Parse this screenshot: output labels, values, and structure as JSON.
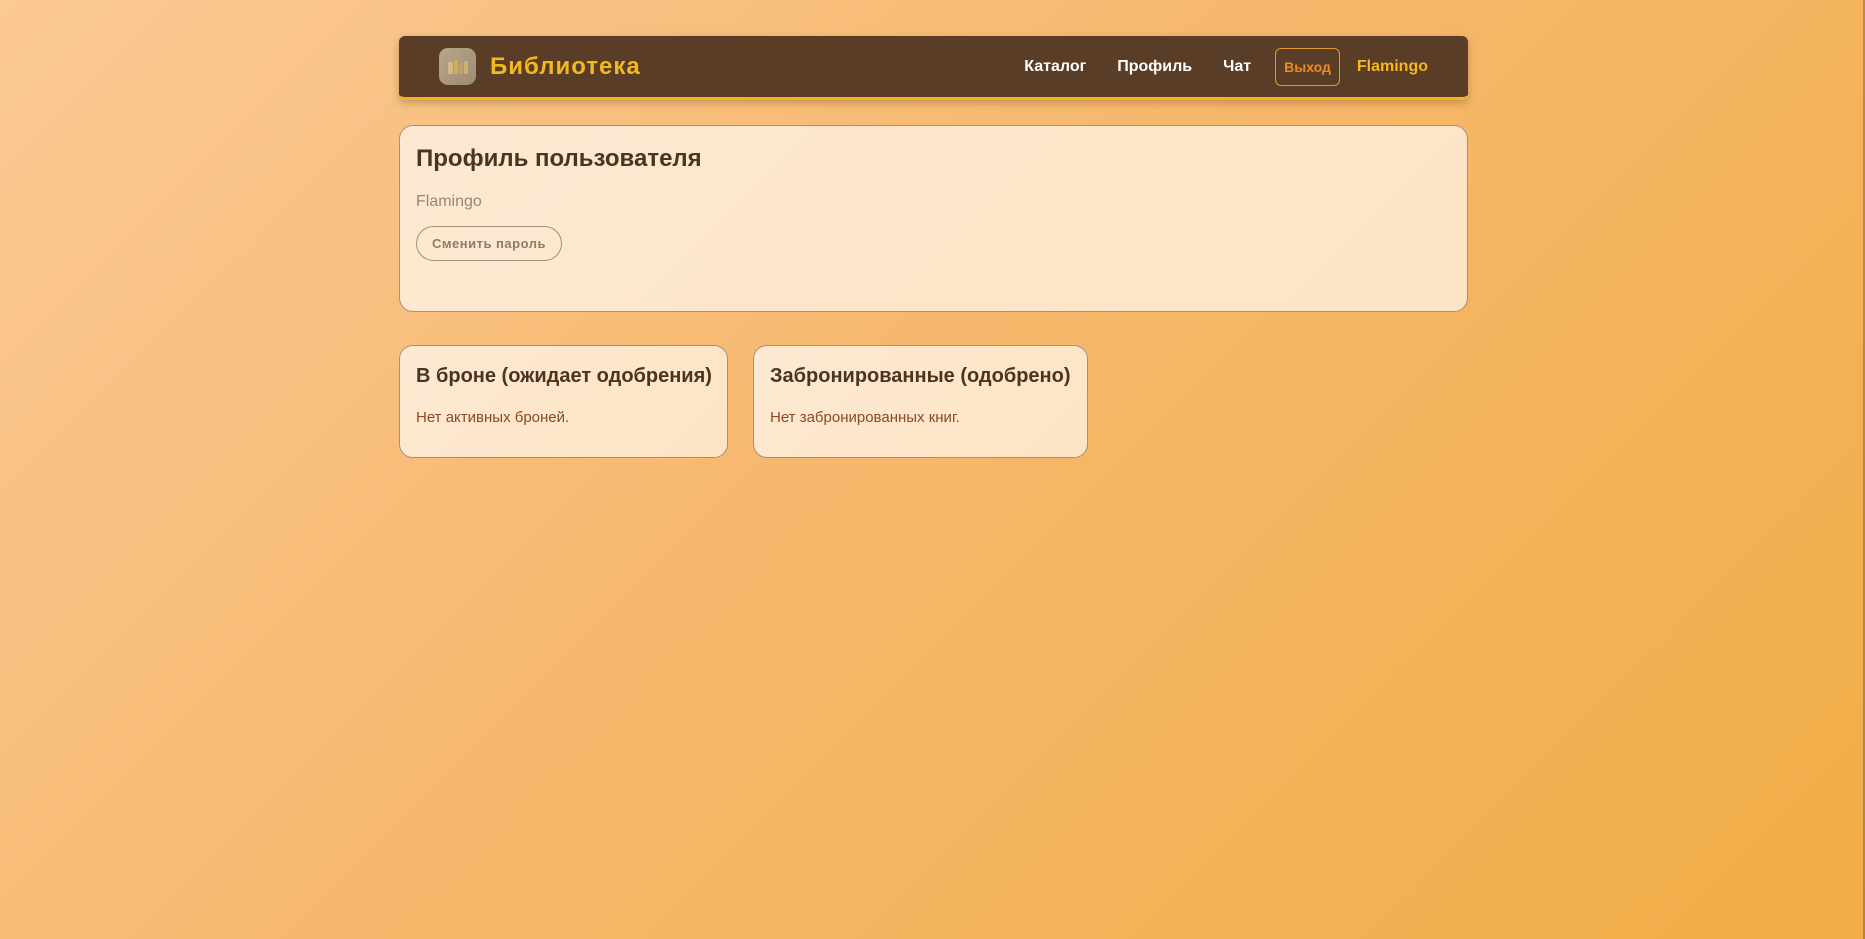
{
  "header": {
    "brand": "Библиотека",
    "logo_icon": "books-icon",
    "nav": {
      "catalog": "Каталог",
      "profile": "Профиль",
      "chat": "Чат",
      "logout": "Выход",
      "username": "Flamingo"
    }
  },
  "profile": {
    "title": "Профиль пользователя",
    "username": "Flamingo",
    "change_password_label": "Сменить пароль"
  },
  "pending": {
    "title": "В броне (ожидает одобрения)",
    "empty_text": "Нет активных броней."
  },
  "approved": {
    "title": "Забронированные (одобрено)",
    "empty_text": "Нет забронированных книг."
  },
  "colors": {
    "navbar": "#5a3d26",
    "accent": "#f2b81e",
    "logout": "#f08a1c",
    "card_bg": "#fde8d2",
    "heading": "#4b3421",
    "muted_text": "#8a4a22"
  }
}
